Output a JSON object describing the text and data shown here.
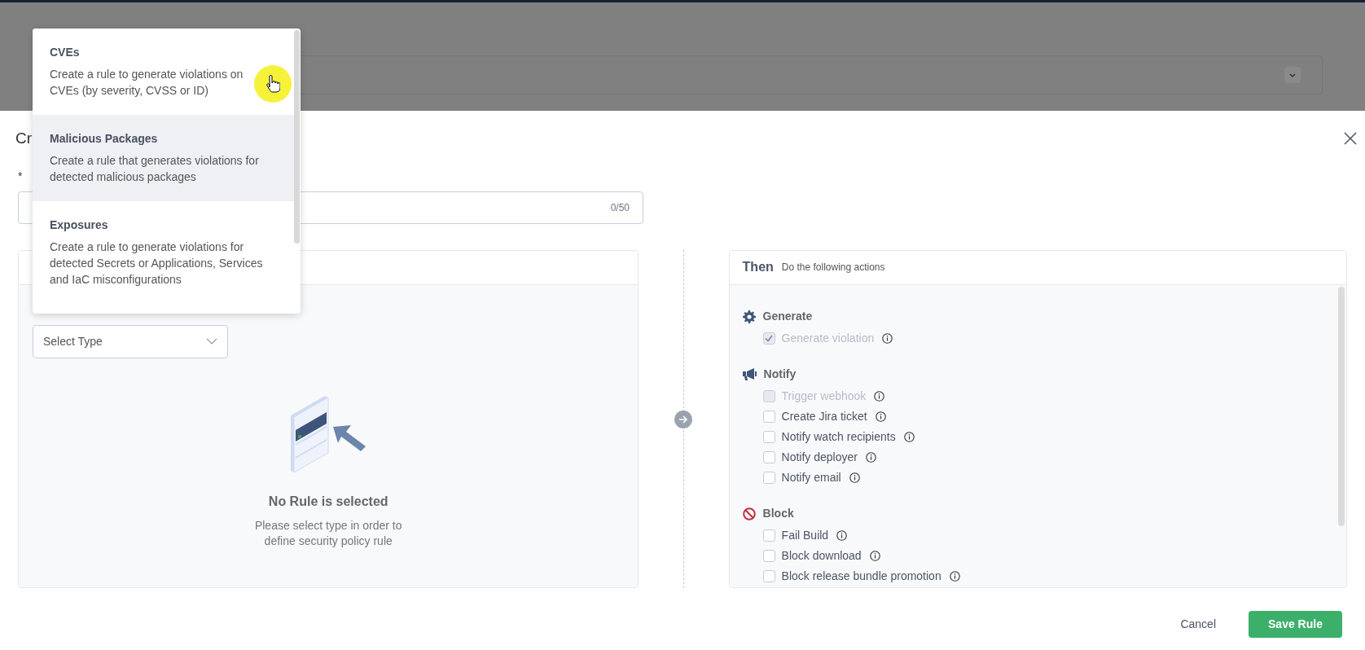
{
  "modal": {
    "title": "Cr",
    "name_label": "*",
    "name_counter": "0/50"
  },
  "rule_panel": {
    "select_placeholder": "Select Type",
    "empty_title": "No Rule is selected",
    "empty_text": "Please select type in order to define security policy rule"
  },
  "actions_panel": {
    "title": "Then",
    "subtitle": "Do the following actions",
    "groups": [
      {
        "kind": "generate",
        "title": "Generate",
        "items": [
          {
            "label": "Generate violation",
            "checked": true,
            "disabled": true
          }
        ]
      },
      {
        "kind": "notify",
        "title": "Notify",
        "items": [
          {
            "label": "Trigger webhook",
            "checked": false,
            "disabled": true
          },
          {
            "label": "Create Jira ticket",
            "checked": false,
            "disabled": false
          },
          {
            "label": "Notify watch recipients",
            "checked": false,
            "disabled": false
          },
          {
            "label": "Notify deployer",
            "checked": false,
            "disabled": false
          },
          {
            "label": "Notify email",
            "checked": false,
            "disabled": false
          }
        ]
      },
      {
        "kind": "block",
        "title": "Block",
        "items": [
          {
            "label": "Fail Build",
            "checked": false,
            "disabled": false
          },
          {
            "label": "Block download",
            "checked": false,
            "disabled": false
          },
          {
            "label": "Block release bundle promotion",
            "checked": false,
            "disabled": false
          }
        ]
      }
    ]
  },
  "rule_type_menu": [
    {
      "title": "CVEs",
      "description": "Create a rule to generate violations on CVEs (by severity, CVSS or ID)",
      "highlighted": false
    },
    {
      "title": "Malicious Packages",
      "description": "Create a rule that generates violations for detected malicious packages",
      "highlighted": true
    },
    {
      "title": "Exposures",
      "description": "Create a rule to generate violations for detected Secrets or Applications, Services and IaC misconfigurations",
      "highlighted": false
    }
  ],
  "buttons": {
    "cancel": "Cancel",
    "save": "Save Rule"
  }
}
